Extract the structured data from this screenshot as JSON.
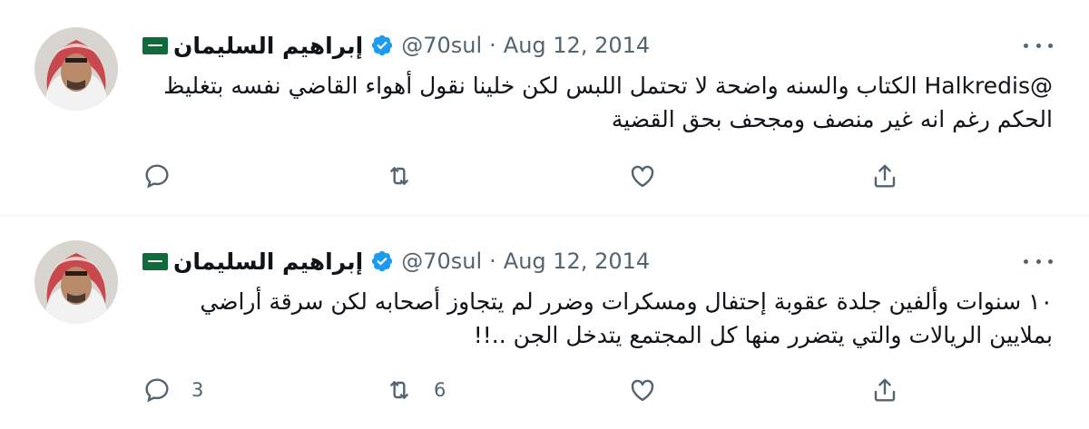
{
  "tweets": [
    {
      "author_name": "إبراهيم السليمان",
      "handle": "@70sul",
      "separator": "·",
      "date": "Aug 12, 2014",
      "text": "@Halkredis الكتاب والسنه واضحة لا تحتمل اللبس لكن خلينا نقول أهواء القاضي نفسه بتغليظ الحكم رغم انه غير منصف ومجحف بحق القضية",
      "reply_count": "",
      "retweet_count": ""
    },
    {
      "author_name": "إبراهيم السليمان",
      "handle": "@70sul",
      "separator": "·",
      "date": "Aug 12, 2014",
      "text": "١٠ سنوات وألفين جلدة عقوبة إحتفال ومسكرات وضرر لم يتجاوز أصحابه لكن سرقة أراضي بملايين الريالات والتي يتضرر منها كل المجتمع يتدخل الجن ..!!",
      "reply_count": "3",
      "retweet_count": "6"
    }
  ],
  "icons": {
    "flag": "saudi-flag-icon",
    "verified": "verified-badge-icon",
    "more": "more-options-icon",
    "reply": "reply-icon",
    "retweet": "retweet-icon",
    "like": "like-icon",
    "share": "share-icon"
  },
  "colors": {
    "text": "#0f1419",
    "secondary": "#536471",
    "verified": "#1d9bf0",
    "flag": "#0f6b3a",
    "divider": "#eff3f4"
  }
}
